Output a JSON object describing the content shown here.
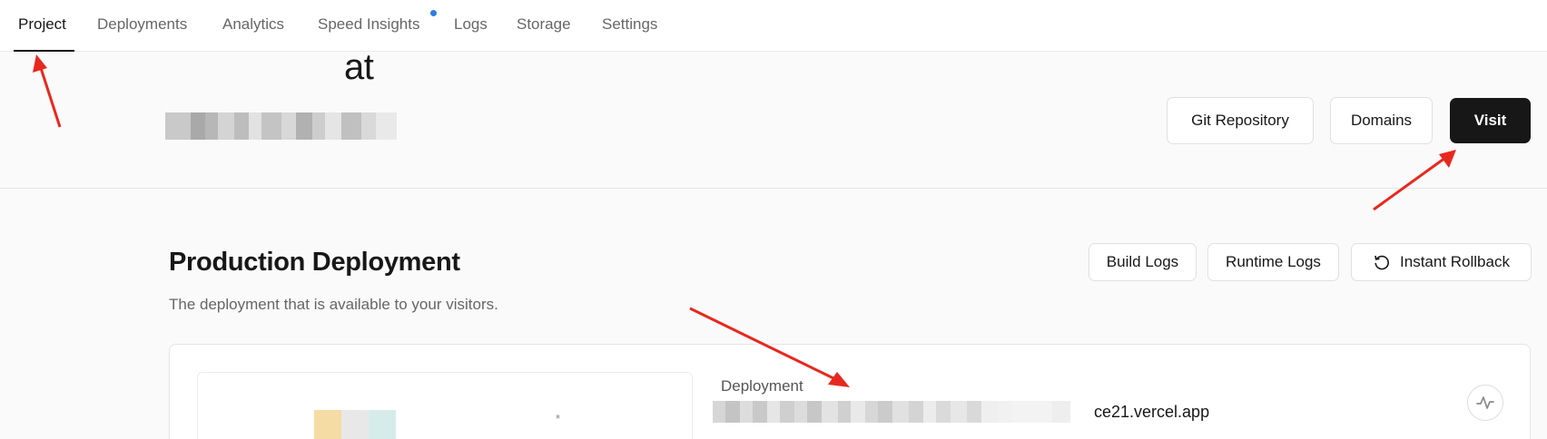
{
  "nav": {
    "tabs": [
      {
        "label": "Project",
        "active": true
      },
      {
        "label": "Deployments"
      },
      {
        "label": "Analytics"
      },
      {
        "label": "Speed Insights",
        "has_dot": true
      },
      {
        "label": "Logs"
      },
      {
        "label": "Storage"
      },
      {
        "label": "Settings"
      }
    ]
  },
  "header": {
    "project_name_visible": "at",
    "buttons": {
      "git_repository": "Git Repository",
      "domains": "Domains",
      "visit": "Visit"
    }
  },
  "production": {
    "title": "Production Deployment",
    "subtitle": "The deployment that is available to your visitors.",
    "buttons": {
      "build_logs": "Build Logs",
      "runtime_logs": "Runtime Logs",
      "instant_rollback": "Instant Rollback"
    },
    "card": {
      "deployment_label": "Deployment",
      "deployment_url_visible": "ce21.vercel.app",
      "preview_star": "*"
    }
  },
  "colors": {
    "accent_dot": "#2f7de1",
    "annotation_arrow": "#e8281e",
    "visit_bg": "#171717"
  },
  "icons": [
    "rollback-icon",
    "activity-icon"
  ]
}
